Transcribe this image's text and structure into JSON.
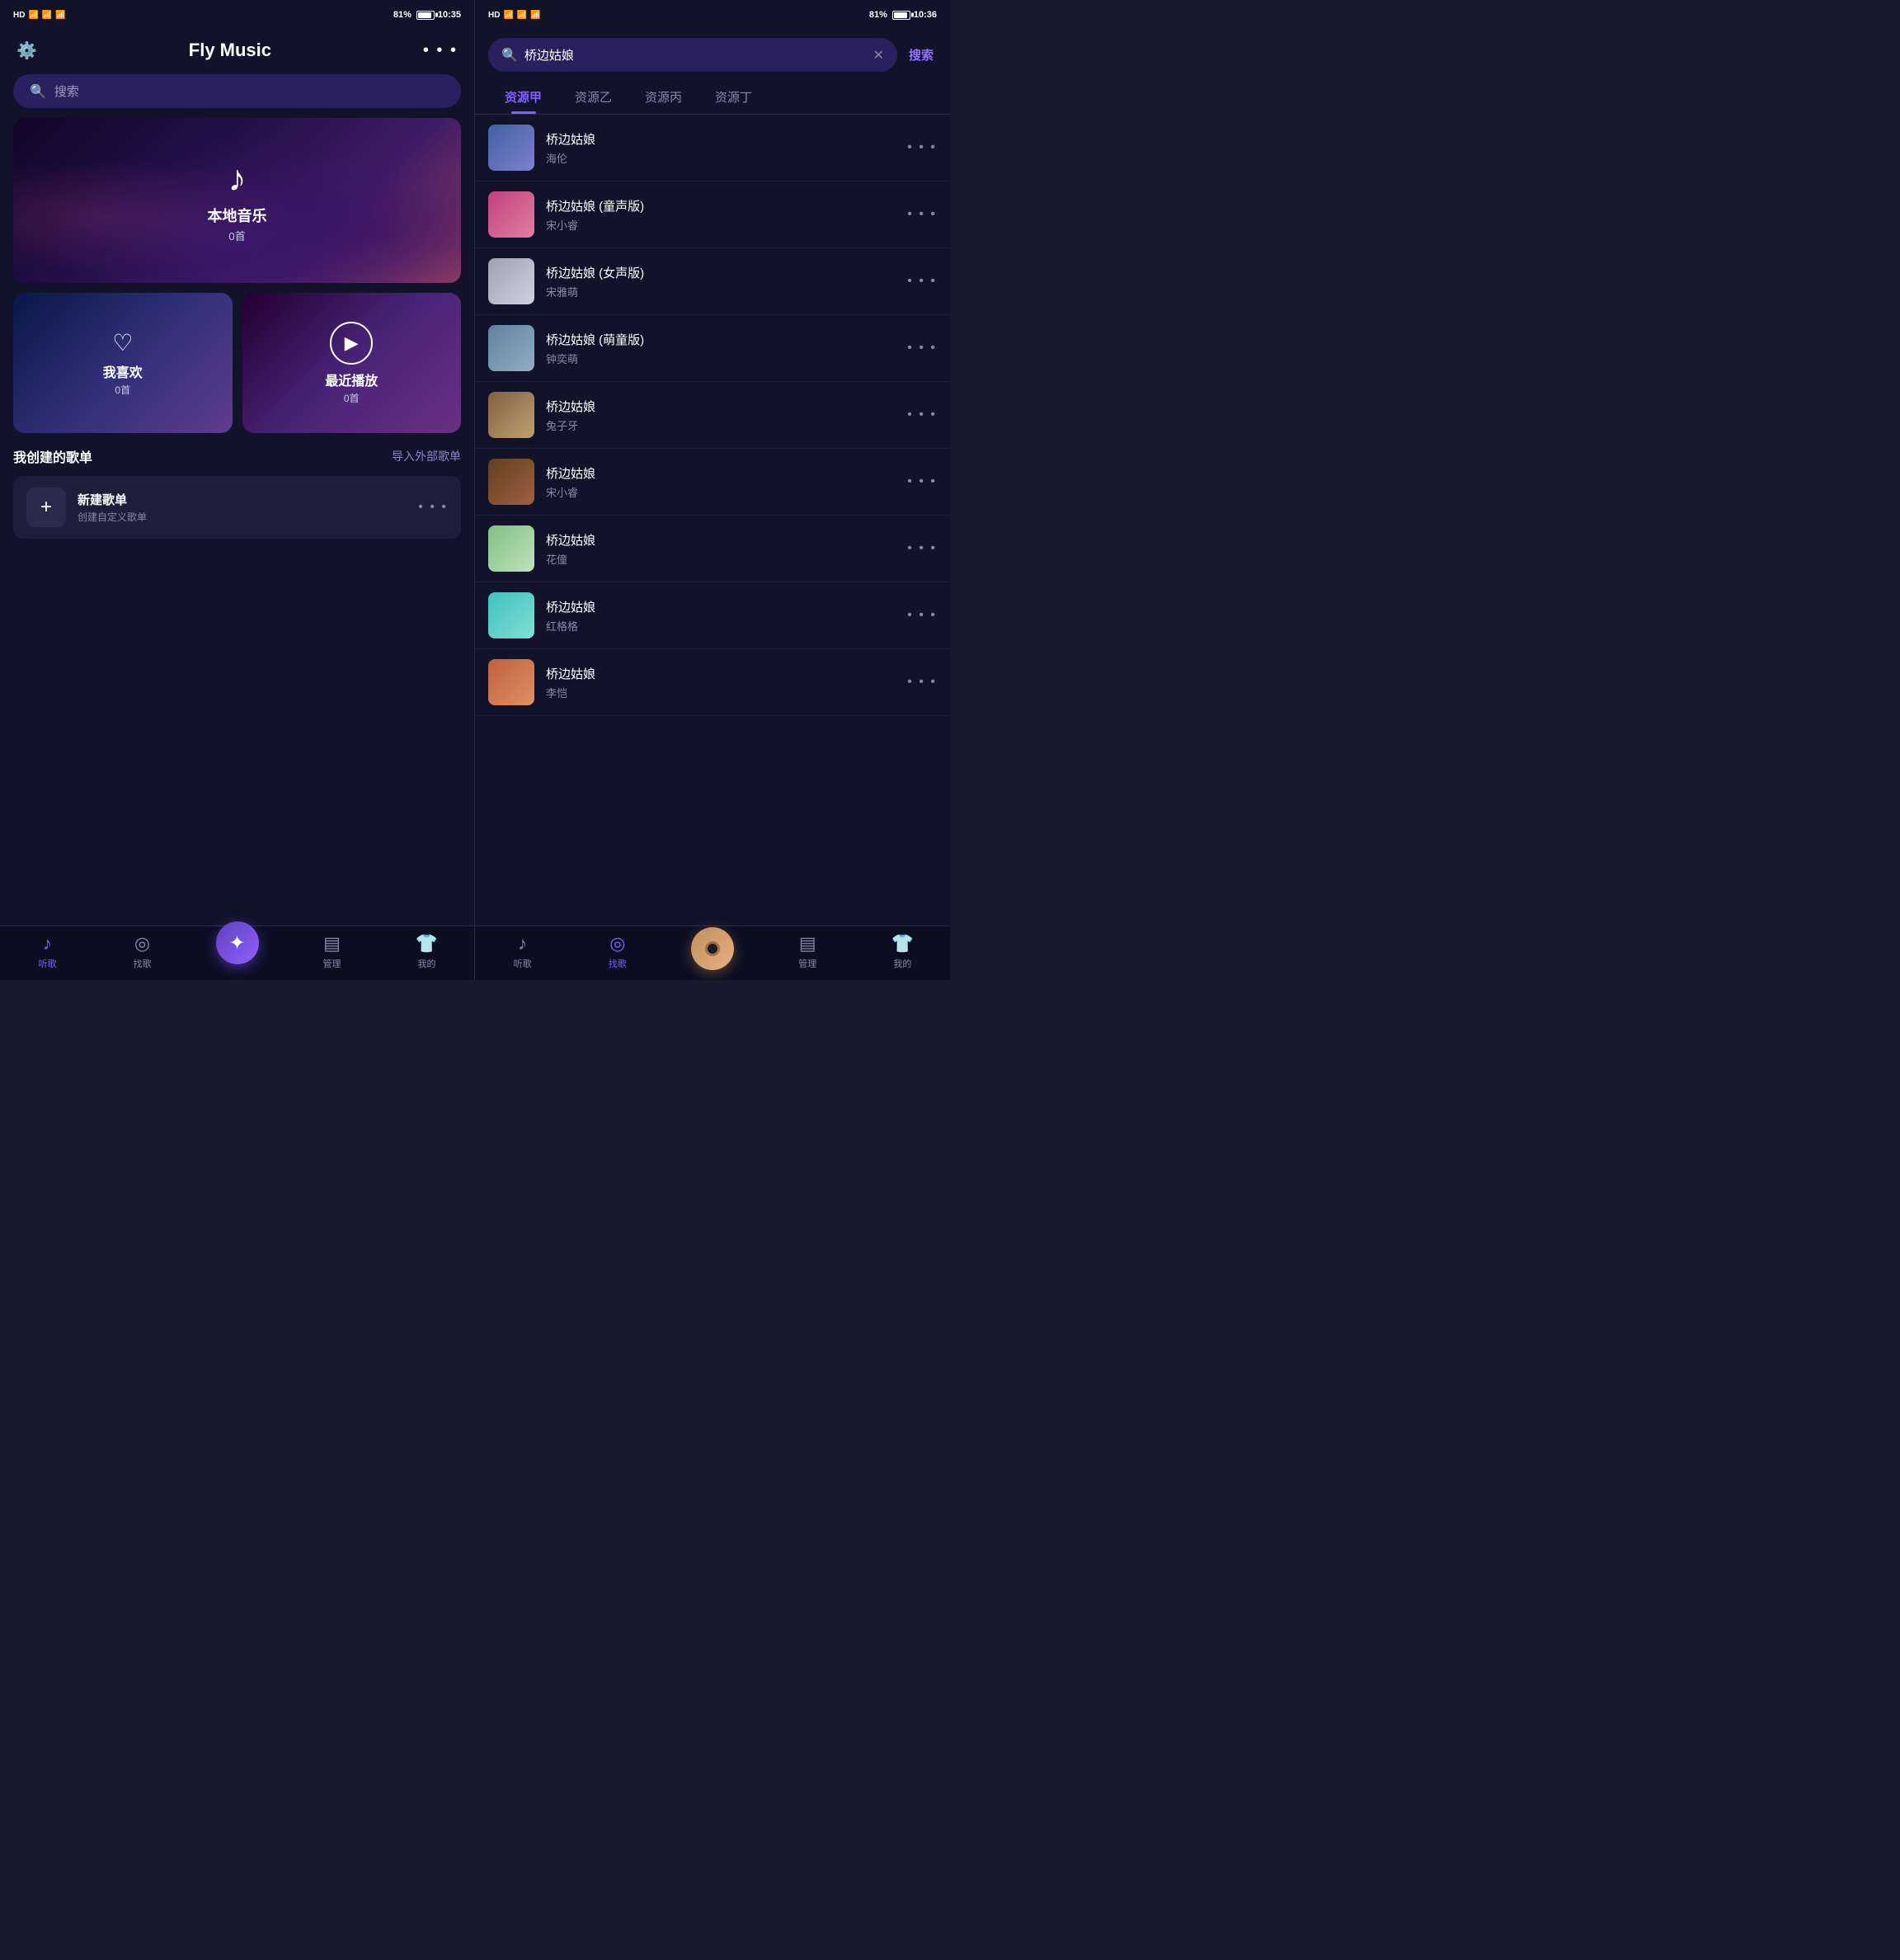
{
  "left": {
    "statusBar": {
      "signal": "HD 46 46",
      "wifi": "WiFi",
      "battery": "81%",
      "time": "10:35"
    },
    "header": {
      "settingsIcon": "⚙",
      "title": "Fly Music",
      "moreIcon": "..."
    },
    "searchBar": {
      "icon": "🔍",
      "placeholder": "搜索"
    },
    "featuredBanner": {
      "icon": "♪",
      "title": "本地音乐",
      "count": "0首"
    },
    "cards": [
      {
        "id": "favorites",
        "title": "我喜欢",
        "count": "0首",
        "iconType": "heart"
      },
      {
        "id": "recent",
        "title": "最近播放",
        "count": "0首",
        "iconType": "play"
      }
    ],
    "playlistSection": {
      "title": "我创建的歌单",
      "importBtn": "导入外部歌单",
      "newPlaylist": {
        "plusIcon": "+",
        "title": "新建歌单",
        "subtitle": "创建自定义歌单",
        "moreIcon": "..."
      }
    },
    "bottomNav": [
      {
        "id": "listen",
        "label": "听歌",
        "icon": "♪",
        "active": true
      },
      {
        "id": "find",
        "label": "找歌",
        "icon": "◎",
        "active": false
      },
      {
        "id": "center",
        "label": "",
        "icon": "✦",
        "active": false,
        "isCenter": true
      },
      {
        "id": "manage",
        "label": "管理",
        "icon": "▦",
        "active": false
      },
      {
        "id": "mine",
        "label": "我的",
        "icon": "👕",
        "active": false
      }
    ]
  },
  "right": {
    "statusBar": {
      "signal": "HD 46 46",
      "wifi": "WiFi",
      "battery": "81%",
      "time": "10:36"
    },
    "searchInput": {
      "icon": "🔍",
      "query": "桥边姑娘",
      "clearIcon": "✕",
      "searchBtn": "搜索"
    },
    "sourceTabs": [
      {
        "id": "jia",
        "label": "资源甲",
        "active": true
      },
      {
        "id": "yi",
        "label": "资源乙",
        "active": false
      },
      {
        "id": "bing",
        "label": "资源丙",
        "active": false
      },
      {
        "id": "ding",
        "label": "资源丁",
        "active": false
      }
    ],
    "results": [
      {
        "id": 1,
        "title": "桥边姑娘",
        "artist": "海伦",
        "thumbClass": "thumb-1"
      },
      {
        "id": 2,
        "title": "桥边姑娘 (童声版)",
        "artist": "宋小睿",
        "thumbClass": "thumb-2"
      },
      {
        "id": 3,
        "title": "桥边姑娘 (女声版)",
        "artist": "宋雅萌",
        "thumbClass": "thumb-3"
      },
      {
        "id": 4,
        "title": "桥边姑娘 (萌童版)",
        "artist": "钟奕萌",
        "thumbClass": "thumb-4"
      },
      {
        "id": 5,
        "title": "桥边姑娘",
        "artist": "兔子牙",
        "thumbClass": "thumb-5"
      },
      {
        "id": 6,
        "title": "桥边姑娘",
        "artist": "宋小睿",
        "thumbClass": "thumb-6"
      },
      {
        "id": 7,
        "title": "桥边姑娘",
        "artist": "花僮",
        "thumbClass": "thumb-7"
      },
      {
        "id": 8,
        "title": "桥边姑娘",
        "artist": "红格格",
        "thumbClass": "thumb-8"
      },
      {
        "id": 9,
        "title": "桥边姑娘",
        "artist": "李恺",
        "thumbClass": "thumb-9"
      }
    ],
    "bottomNav": [
      {
        "id": "listen",
        "label": "听歌",
        "icon": "♪",
        "active": false
      },
      {
        "id": "find",
        "label": "找歌",
        "icon": "◎",
        "active": true
      },
      {
        "id": "center",
        "label": "",
        "active": false,
        "isCenter": true
      },
      {
        "id": "manage",
        "label": "管理",
        "icon": "▦",
        "active": false
      },
      {
        "id": "mine",
        "label": "我的",
        "icon": "👕",
        "active": false
      }
    ]
  }
}
